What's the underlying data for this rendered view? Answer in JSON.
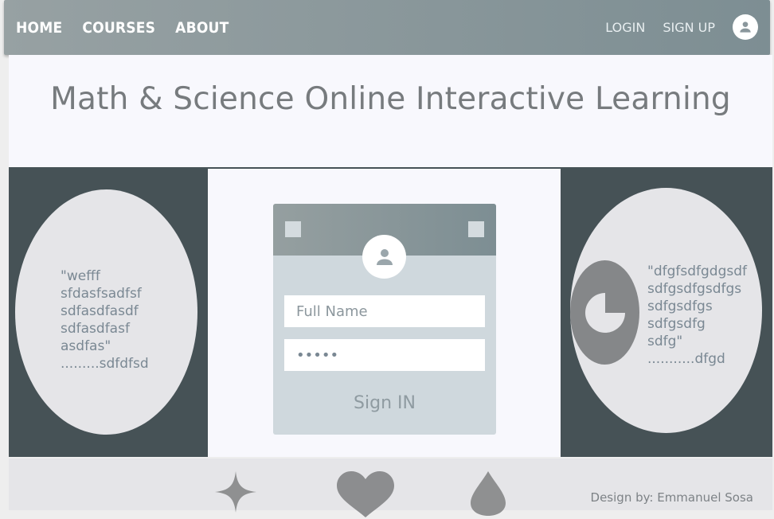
{
  "nav": {
    "links": [
      "HOME",
      "COURSES",
      "ABOUT"
    ],
    "login_label": "LOGIN",
    "signup_label": "SIGN UP",
    "avatar_icon": "user-icon"
  },
  "hero": {
    "title": "Math & Science Online Interactive Learning"
  },
  "left_quote": {
    "lines": [
      "\"wefff",
      "sfdasfsadfsf",
      "sdfasdfasdf",
      "sdfasdfasf",
      "asdfas\""
    ],
    "author": ".........sdfdfsd"
  },
  "right_quote": {
    "lines": [
      "\"dfgfsdfgdgsdf",
      "sdfgsdfgsdfgs",
      "sdfgsdfgs",
      "sdfgsdfg",
      "sdfg\""
    ],
    "author": "...........dfgd",
    "badge_icon": "pie-chart-icon"
  },
  "login_card": {
    "avatar_icon": "user-icon",
    "name_placeholder": "Full Name",
    "password_value": "•••••",
    "submit_label": "Sign IN"
  },
  "footer": {
    "icons": [
      "sparkle-icon",
      "heart-icon",
      "drop-icon"
    ],
    "credit": "Design by: Emmanuel Sosa"
  },
  "colors": {
    "nav_gradient_start": "#97a1a3",
    "nav_gradient_end": "#7d8e93",
    "band": "#465256",
    "card": "#cfd8dd"
  }
}
